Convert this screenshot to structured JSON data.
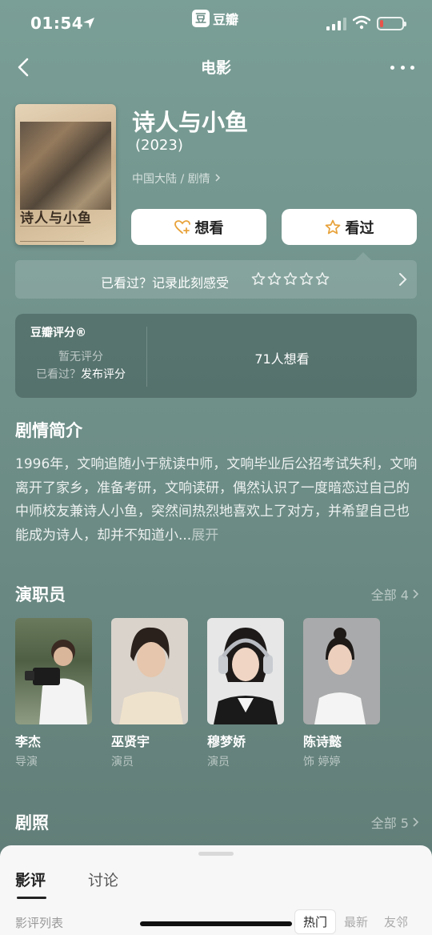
{
  "status_bar": {
    "time": "01:54",
    "app_badge_glyph": "豆",
    "app_name": "豆瓣",
    "battery_color": "#e8534a",
    "battery_level": 0.15
  },
  "nav": {
    "title": "电影"
  },
  "movie": {
    "poster_title": "诗人与小鱼",
    "title": "诗人与小鱼",
    "year": "(2023)",
    "meta": "中国大陆 / 剧情",
    "want_label": "想看",
    "seen_label": "看过",
    "seen_prompt": "已看过？记录此刻感受",
    "stars": 5
  },
  "rating": {
    "title": "豆瓣评分®",
    "no_rating": "暂无评分",
    "seen_prefix": "已看过？",
    "publish_label": "发布评分",
    "want_count": "71人想看"
  },
  "synopsis": {
    "heading": "剧情简介",
    "text": "1996年，文响追随小于就读中师，文响毕业后公招考试失利，文响离开了家乡，准备考研，文响读研，偶然认识了一度暗恋过自己的中师校友兼诗人小鱼，突然间热烈地喜欢上了对方，并希望自己也能成为诗人，却并不知道小...",
    "expand_label": "展开"
  },
  "cast": {
    "heading": "演职员",
    "see_all": "全部 4",
    "members": [
      {
        "name": "李杰",
        "role": "导演"
      },
      {
        "name": "巫贤宇",
        "role": "演员"
      },
      {
        "name": "穆梦娇",
        "role": "演员"
      },
      {
        "name": "陈诗懿",
        "role": "饰 婷婷"
      }
    ]
  },
  "stills": {
    "heading": "剧照",
    "see_all": "全部 5"
  },
  "sheet": {
    "tab_reviews": "影评",
    "tab_discussion": "讨论",
    "list_label": "影评列表",
    "sort_options": [
      "热门",
      "最新",
      "友邻"
    ]
  },
  "colors": {
    "background": "#6e8f88",
    "accent": "#e8a23a",
    "sheet": "#f7f7f7"
  }
}
